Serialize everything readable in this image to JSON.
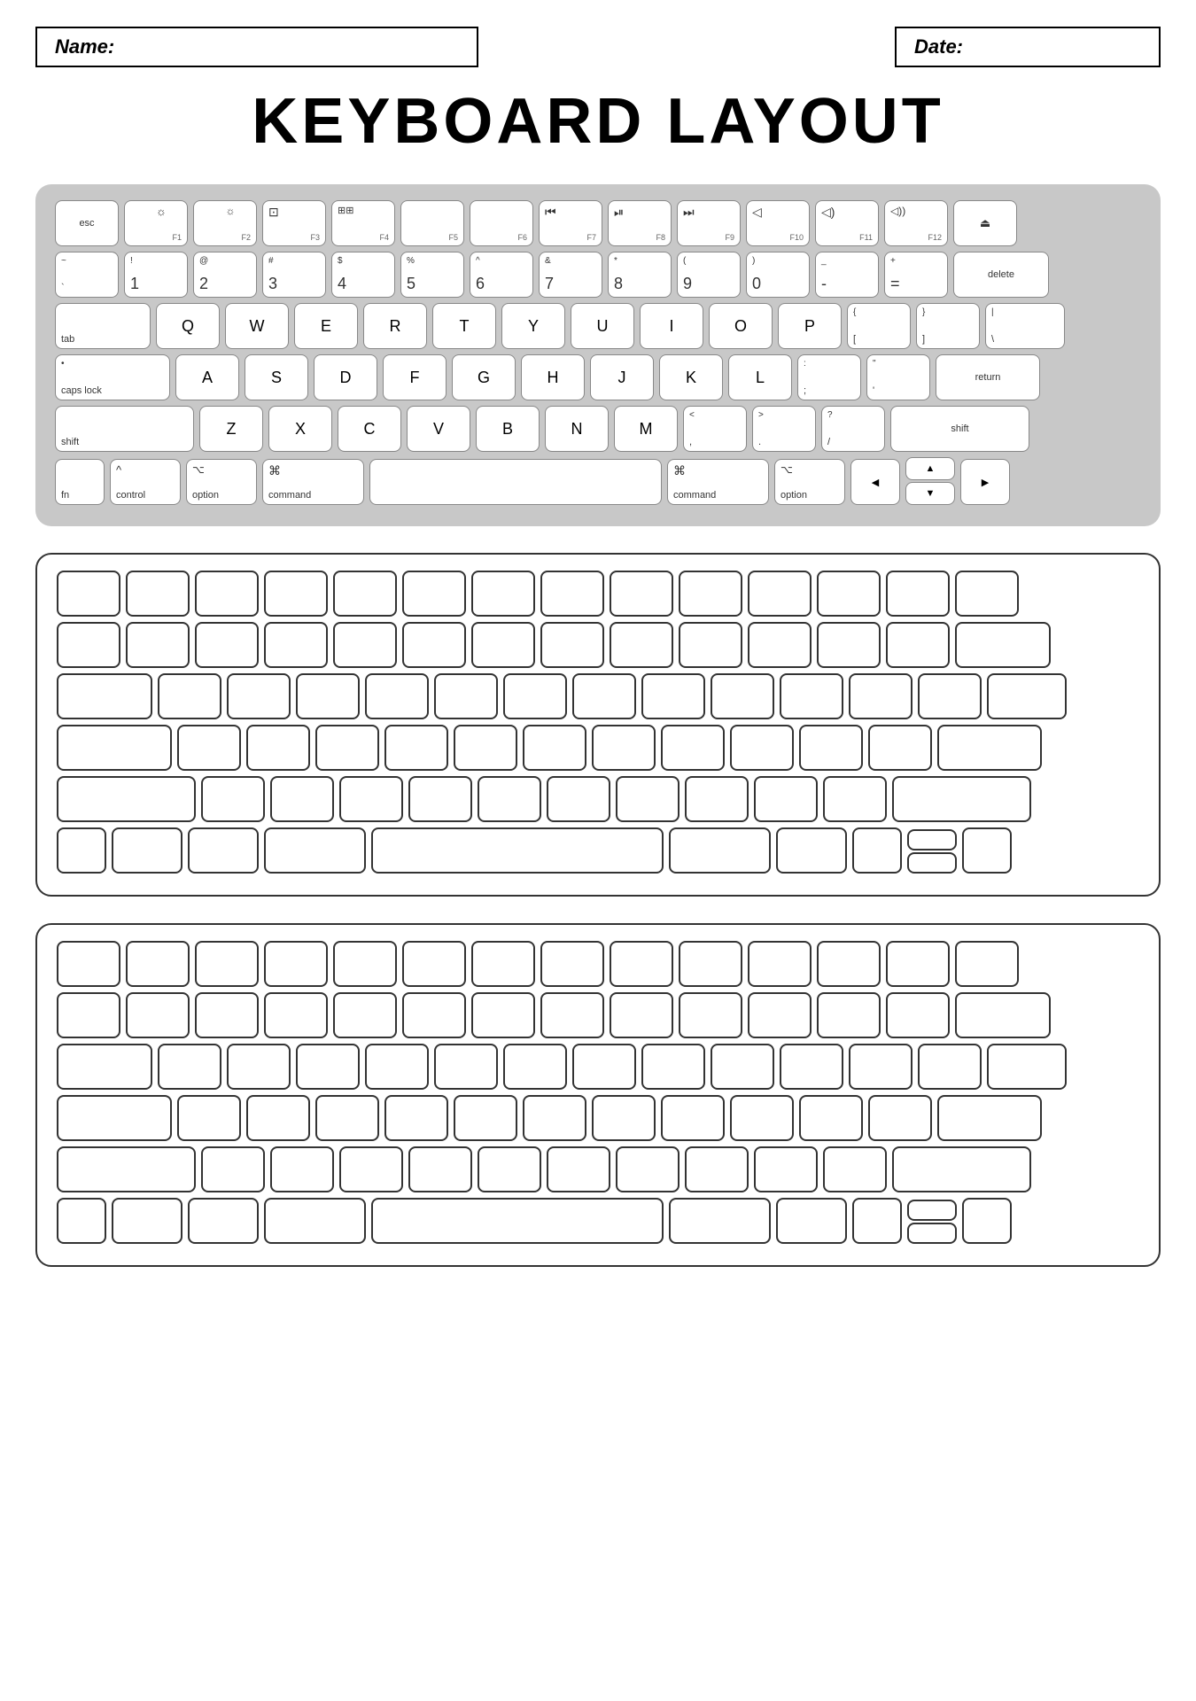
{
  "header": {
    "name_label": "Name:",
    "date_label": "Date:"
  },
  "title": "KEYBOARD LAYOUT",
  "keyboard1": {
    "rows": [
      {
        "keys": [
          {
            "id": "esc",
            "bottom": "esc",
            "size": "esc"
          },
          {
            "id": "f1",
            "icon": "☼",
            "fn": "F1",
            "size": "fn"
          },
          {
            "id": "f2",
            "icon": "☼",
            "fn": "F2",
            "size": "fn"
          },
          {
            "id": "f3",
            "icon": "⊞",
            "fn": "F3",
            "size": "fn"
          },
          {
            "id": "f4",
            "icon": "⊞⊞",
            "fn": "F4",
            "size": "fn"
          },
          {
            "id": "f5",
            "fn": "F5",
            "size": "fn"
          },
          {
            "id": "f6",
            "fn": "F6",
            "size": "fn"
          },
          {
            "id": "f7",
            "icon": "⏮",
            "fn": "F7",
            "size": "fn"
          },
          {
            "id": "f8",
            "icon": "⏯",
            "fn": "F8",
            "size": "fn"
          },
          {
            "id": "f9",
            "icon": "⏭",
            "fn": "F9",
            "size": "fn"
          },
          {
            "id": "f10",
            "icon": "🔇",
            "fn": "F10",
            "size": "fn"
          },
          {
            "id": "f11",
            "icon": "🔈",
            "fn": "F11",
            "size": "fn"
          },
          {
            "id": "f12",
            "icon": "🔊",
            "fn": "F12",
            "size": "fn"
          },
          {
            "id": "eject",
            "icon": "⏏",
            "size": "fn"
          }
        ]
      }
    ]
  }
}
